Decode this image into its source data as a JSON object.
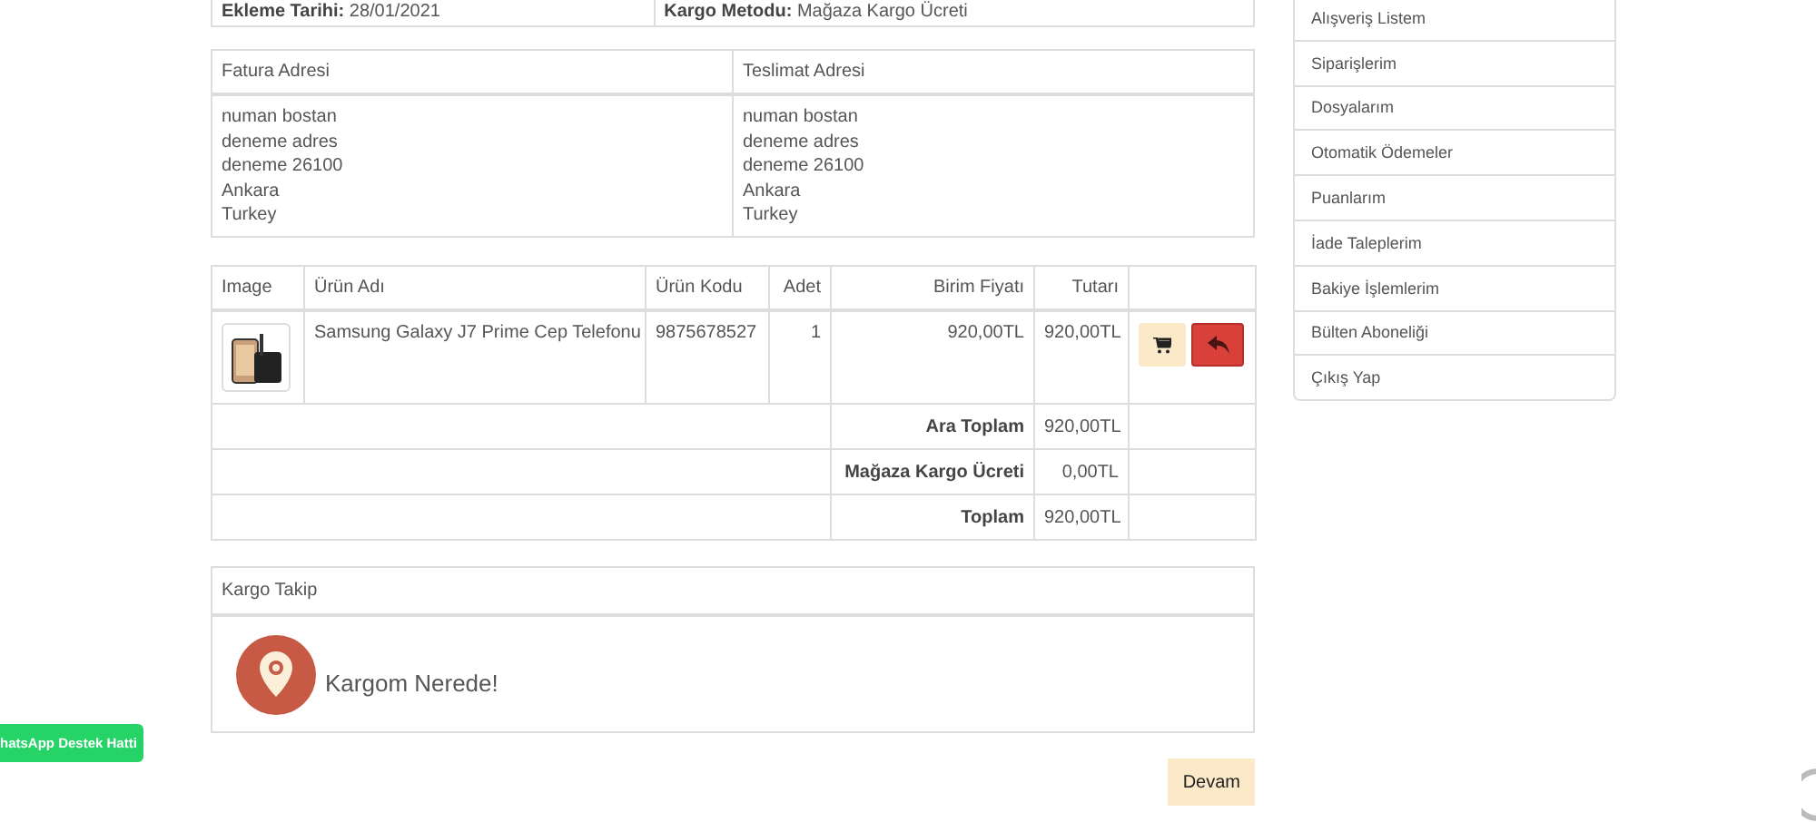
{
  "order_info": [
    {
      "label": "Ekleme Tarihi:",
      "value": "28/01/2021"
    },
    {
      "label": "Kargo Metodu:",
      "value": "Mağaza Kargo Ücreti"
    }
  ],
  "addresses": {
    "columns": [
      "Fatura Adresi",
      "Teslimat Adresi"
    ],
    "lines": [
      [
        "numan bostan",
        "deneme adres",
        "deneme 26100",
        "Ankara",
        "Turkey"
      ],
      [
        "numan bostan",
        "deneme adres",
        "deneme 26100",
        "Ankara",
        "Turkey"
      ]
    ]
  },
  "products": {
    "columns": [
      "Image",
      "Ürün Adı",
      "Ürün Kodu",
      "Adet",
      "Birim Fiyatı",
      "Tutarı"
    ],
    "rows": [
      {
        "name": "Samsung Galaxy J7 Prime Cep Telefonu",
        "code": "9875678527",
        "quantity": "1",
        "unit_price": "920,00TL",
        "total": "920,00TL"
      }
    ],
    "totals": [
      {
        "label": "Ara Toplam",
        "value": "920,00TL"
      },
      {
        "label": "Mağaza Kargo Ücreti",
        "value": "0,00TL"
      },
      {
        "label": "Toplam",
        "value": "920,00TL"
      }
    ]
  },
  "cargo_tracking": {
    "title": "Kargo Takip",
    "link": "Kargom Nerede!"
  },
  "continue_button": "Devam",
  "whatsapp_button": "hatsApp Destek Hatti",
  "sidebar": {
    "items": [
      "Alışveriş Listem",
      "Siparişlerim",
      "Dosyalarım",
      "Otomatik Ödemeler",
      "Puanlarım",
      "İade Taleplerim",
      "Bakiye İşlemlerim",
      "Bülten Aboneliği",
      "Çıkış Yap"
    ]
  }
}
